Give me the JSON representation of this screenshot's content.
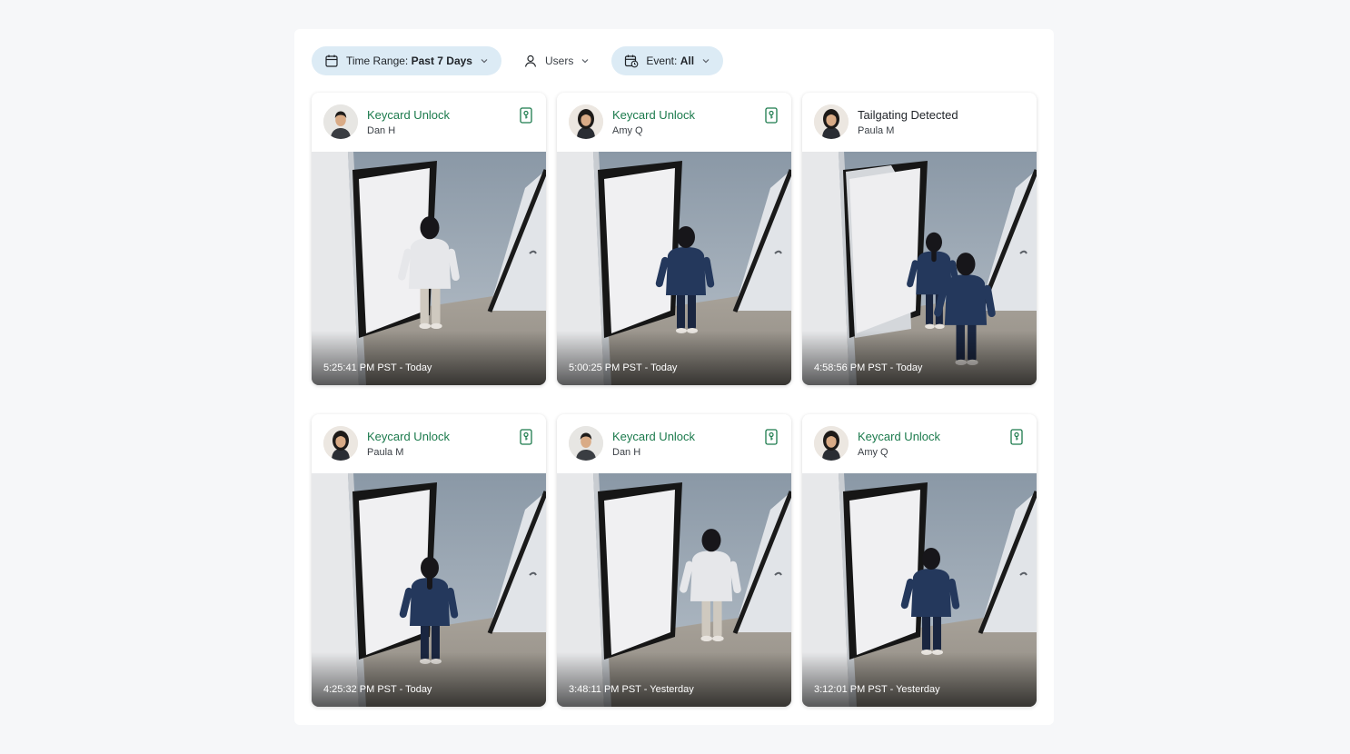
{
  "filters": {
    "time_range": {
      "label": "Time Range: ",
      "value": "Past 7 Days",
      "icon": "calendar-icon"
    },
    "users": {
      "label": "Users",
      "icon": "user-icon"
    },
    "event": {
      "label": "Event: ",
      "value": "All",
      "icon": "calendar-clock-icon"
    }
  },
  "colors": {
    "accent": "#1b7a4c",
    "chip_bg": "#dcebf5"
  },
  "events": [
    {
      "title": "Keycard Unlock",
      "user": "Dan H",
      "time": "5:25:41 PM PST - Today",
      "type": "keycard",
      "scene": "man-white"
    },
    {
      "title": "Keycard Unlock",
      "user": "Amy Q",
      "time": "5:00:25 PM PST - Today",
      "type": "keycard",
      "scene": "woman-navy-short"
    },
    {
      "title": "Tailgating Detected",
      "user": "Paula M",
      "time": "4:58:56 PM PST - Today",
      "type": "alert",
      "scene": "two-people"
    },
    {
      "title": "Keycard Unlock",
      "user": "Paula M",
      "time": "4:25:32 PM PST - Today",
      "type": "keycard",
      "scene": "woman-navy-long"
    },
    {
      "title": "Keycard Unlock",
      "user": "Dan H",
      "time": "3:48:11 PM PST - Yesterday",
      "type": "keycard",
      "scene": "man-white-side"
    },
    {
      "title": "Keycard Unlock",
      "user": "Amy Q",
      "time": "3:12:01 PM PST - Yesterday",
      "type": "keycard",
      "scene": "woman-navy-short"
    }
  ]
}
